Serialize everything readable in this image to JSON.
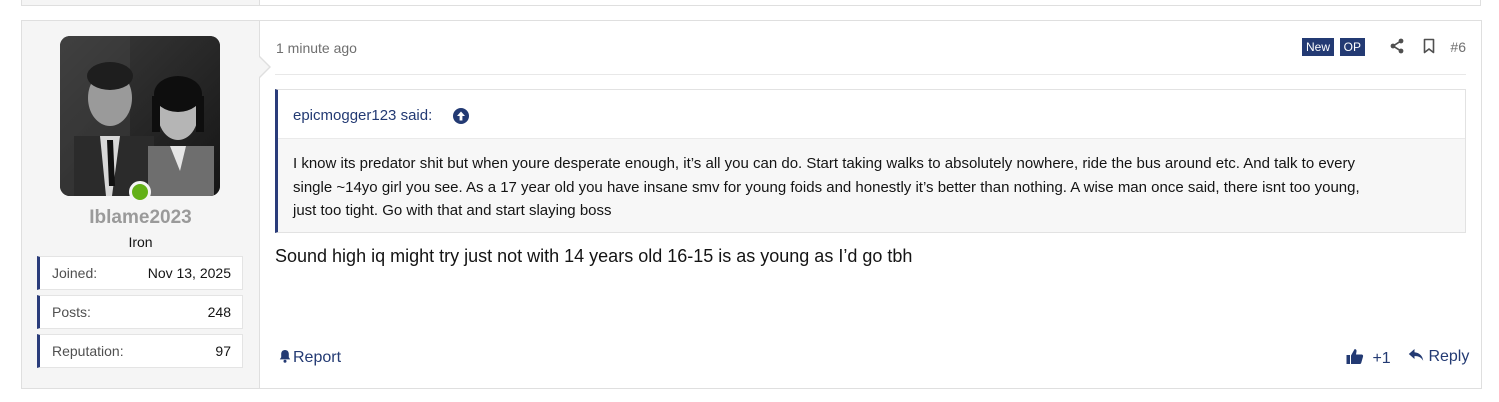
{
  "post": {
    "time": "1 minute ago",
    "badges": {
      "new": "New",
      "op": "OP"
    },
    "number": "#6",
    "message": "Sound high iq might try just not with 14 years old 16-15 is as young as I’d go tbh"
  },
  "user": {
    "name": "Iblame2023",
    "title": "Iron",
    "online_color": "#63b017",
    "stats": [
      {
        "key": "Joined:",
        "value": "Nov 13, 2025"
      },
      {
        "key": "Posts:",
        "value": "248"
      },
      {
        "key": "Reputation:",
        "value": "97"
      }
    ]
  },
  "quote": {
    "author": "epicmogger123 said:",
    "lines": [
      "I know its predator shit but when youre desperate enough, it’s all you can do. Start taking walks to absolutely nowhere, ride the bus around etc. And talk to every",
      "single ~14yo girl you see. As a 17 year old you have insane smv for young foids and honestly it’s better than nothing. A wise man once said, there isnt too young,",
      "just too tight. Go with that and start slaying boss"
    ]
  },
  "footer": {
    "report": "Report",
    "reaction": "+1",
    "reply": "Reply"
  },
  "icons": {
    "share": "share-icon",
    "bookmark": "bookmark-icon",
    "bell": "bell-icon",
    "like": "thumbs-up-icon",
    "reply": "reply-arrow-icon"
  },
  "colors": {
    "accent": "#233a73",
    "username": "#9a9a9a"
  }
}
